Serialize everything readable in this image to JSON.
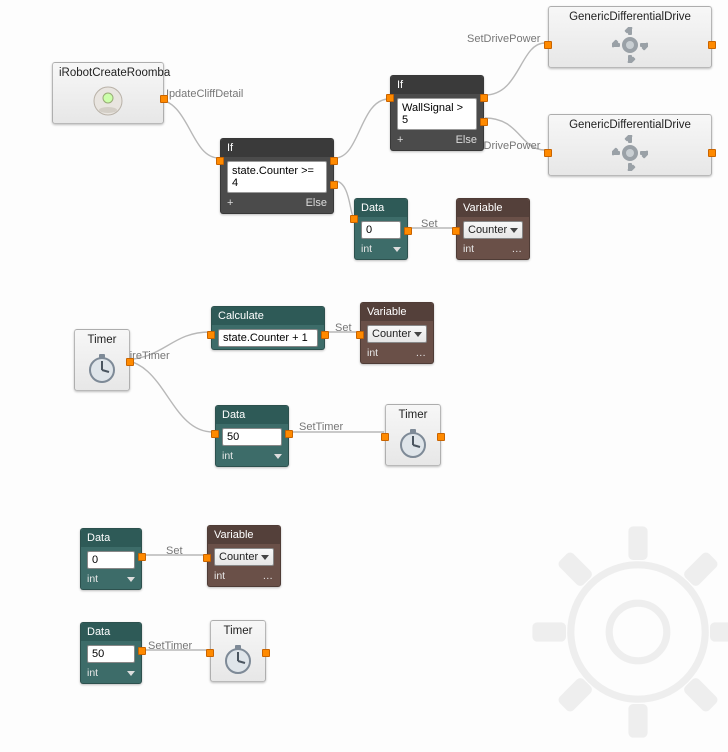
{
  "roomba": {
    "title": "iRobotCreateRoomba"
  },
  "drive1": {
    "title": "GenericDifferentialDrive"
  },
  "drive2": {
    "title": "GenericDifferentialDrive"
  },
  "timer1": {
    "title": "Timer"
  },
  "timer2": {
    "title": "Timer"
  },
  "timer3": {
    "title": "Timer"
  },
  "if1": {
    "header": "If",
    "condition": "state.Counter >= 4",
    "plus": "+",
    "else": "Else"
  },
  "if2": {
    "header": "If",
    "condition": "WallSignal > 5",
    "plus": "+",
    "else": "Else"
  },
  "calc": {
    "header": "Calculate",
    "expr": "state.Counter + 1"
  },
  "data1": {
    "header": "Data",
    "value": "0",
    "type": "int"
  },
  "data2": {
    "header": "Data",
    "value": "50",
    "type": "int"
  },
  "data3": {
    "header": "Data",
    "value": "0",
    "type": "int"
  },
  "data4": {
    "header": "Data",
    "value": "50",
    "type": "int"
  },
  "var1": {
    "header": "Variable",
    "selected": "Counter",
    "type": "int",
    "ellipsis": "…"
  },
  "var2": {
    "header": "Variable",
    "selected": "Counter",
    "type": "int",
    "ellipsis": "…"
  },
  "var3": {
    "header": "Variable",
    "selected": "Counter",
    "type": "int",
    "ellipsis": "…"
  },
  "labels": {
    "updateCliff": "UpdateCliffDetail",
    "fireTimer": "FireTimer",
    "set": "Set",
    "setTimer": "SetTimer",
    "setDrivePower": "SetDrivePower"
  },
  "icons": {
    "gear": "gear-icon",
    "clock": "clock-icon",
    "roomba": "roomba-icon"
  }
}
